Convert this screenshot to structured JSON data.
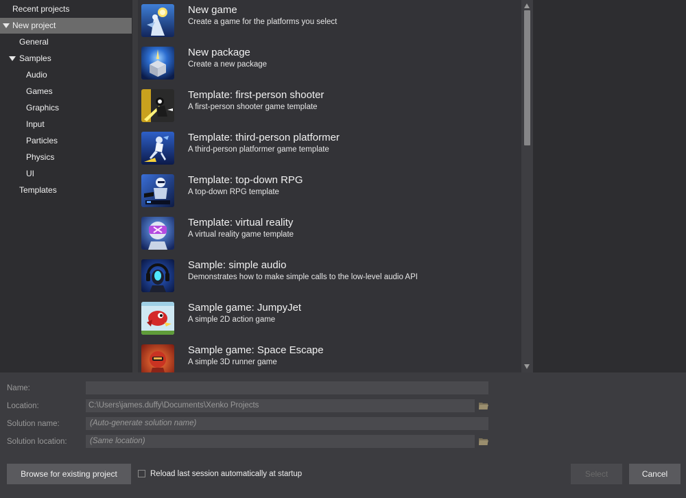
{
  "tree": {
    "items": [
      {
        "label": "Recent projects",
        "expanded": null
      },
      {
        "label": "New project",
        "expanded": true,
        "selected": true
      },
      {
        "label": "General",
        "expanded": null
      },
      {
        "label": "Samples",
        "expanded": true
      },
      {
        "label": "Audio",
        "expanded": null
      },
      {
        "label": "Games",
        "expanded": null
      },
      {
        "label": "Graphics",
        "expanded": null
      },
      {
        "label": "Input",
        "expanded": null
      },
      {
        "label": "Particles",
        "expanded": null
      },
      {
        "label": "Physics",
        "expanded": null
      },
      {
        "label": "UI",
        "expanded": null
      },
      {
        "label": "Templates",
        "expanded": null
      }
    ]
  },
  "templates": [
    {
      "title": "New game",
      "description": "Create a game for the platforms you select",
      "icon": "new-game-thumbnail"
    },
    {
      "title": "New package",
      "description": "Create a new package",
      "icon": "new-package-thumbnail"
    },
    {
      "title": "Template: first-person shooter",
      "description": "A first-person shooter game template",
      "icon": "fps-template-thumbnail"
    },
    {
      "title": "Template: third-person platformer",
      "description": "A third-person platformer game template",
      "icon": "platformer-template-thumbnail"
    },
    {
      "title": "Template: top-down RPG",
      "description": "A top-down RPG template",
      "icon": "rpg-template-thumbnail"
    },
    {
      "title": "Template: virtual reality",
      "description": "A virtual reality game template",
      "icon": "vr-template-thumbnail"
    },
    {
      "title": "Sample: simple audio",
      "description": "Demonstrates how to make simple calls to the low-level audio API",
      "icon": "audio-sample-thumbnail"
    },
    {
      "title": "Sample game: JumpyJet",
      "description": "A simple 2D action game",
      "icon": "jumpyjet-thumbnail"
    },
    {
      "title": "Sample game: Space Escape",
      "description": "A simple 3D runner game",
      "icon": "space-escape-thumbnail"
    }
  ],
  "form": {
    "name_label": "Name:",
    "name_value": "",
    "location_label": "Location:",
    "location_value": "C:\\Users\\james.duffy\\Documents\\Xenko Projects",
    "solution_name_label": "Solution name:",
    "solution_name_placeholder": "(Auto-generate solution name)",
    "solution_location_label": "Solution location:",
    "solution_location_placeholder": "(Same location)"
  },
  "footer": {
    "browse_label": "Browse for existing project",
    "reload_label": "Reload last session automatically at startup",
    "reload_checked": false,
    "select_label": "Select",
    "cancel_label": "Cancel"
  },
  "colors": {
    "background": "#2d2d30",
    "list_background": "#333337",
    "selection": "#6b6b6b",
    "form_background": "#3c3c40"
  }
}
